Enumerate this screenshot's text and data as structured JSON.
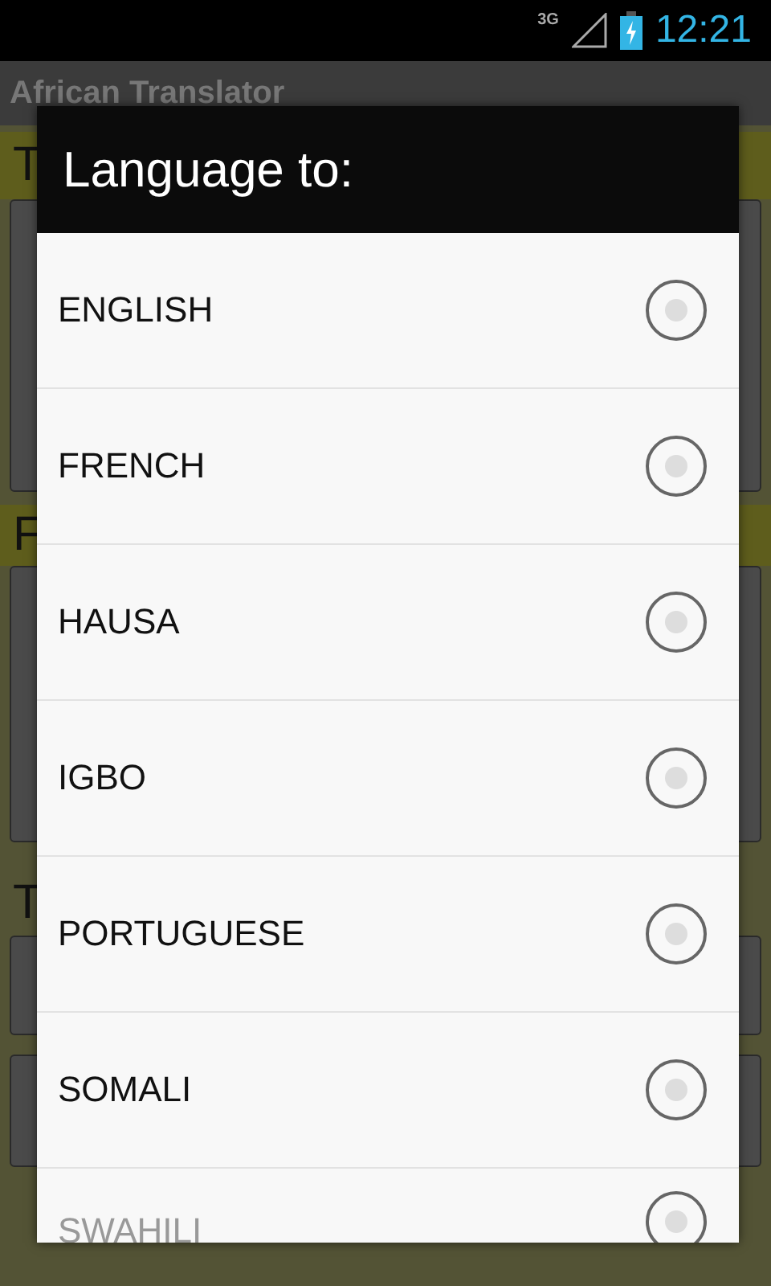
{
  "status_bar": {
    "network": "3G",
    "time": "12:21"
  },
  "app_bar": {
    "title": "African Translator"
  },
  "background": {
    "labels": [
      "T",
      "F",
      "T"
    ]
  },
  "dialog": {
    "title": "Language to:",
    "options": [
      {
        "label": "ENGLISH",
        "selected": false
      },
      {
        "label": "FRENCH",
        "selected": false
      },
      {
        "label": "HAUSA",
        "selected": false
      },
      {
        "label": "IGBO",
        "selected": false
      },
      {
        "label": "PORTUGUESE",
        "selected": false
      },
      {
        "label": "SOMALI",
        "selected": false
      },
      {
        "label": "SWAHILI",
        "selected": false
      }
    ]
  }
}
